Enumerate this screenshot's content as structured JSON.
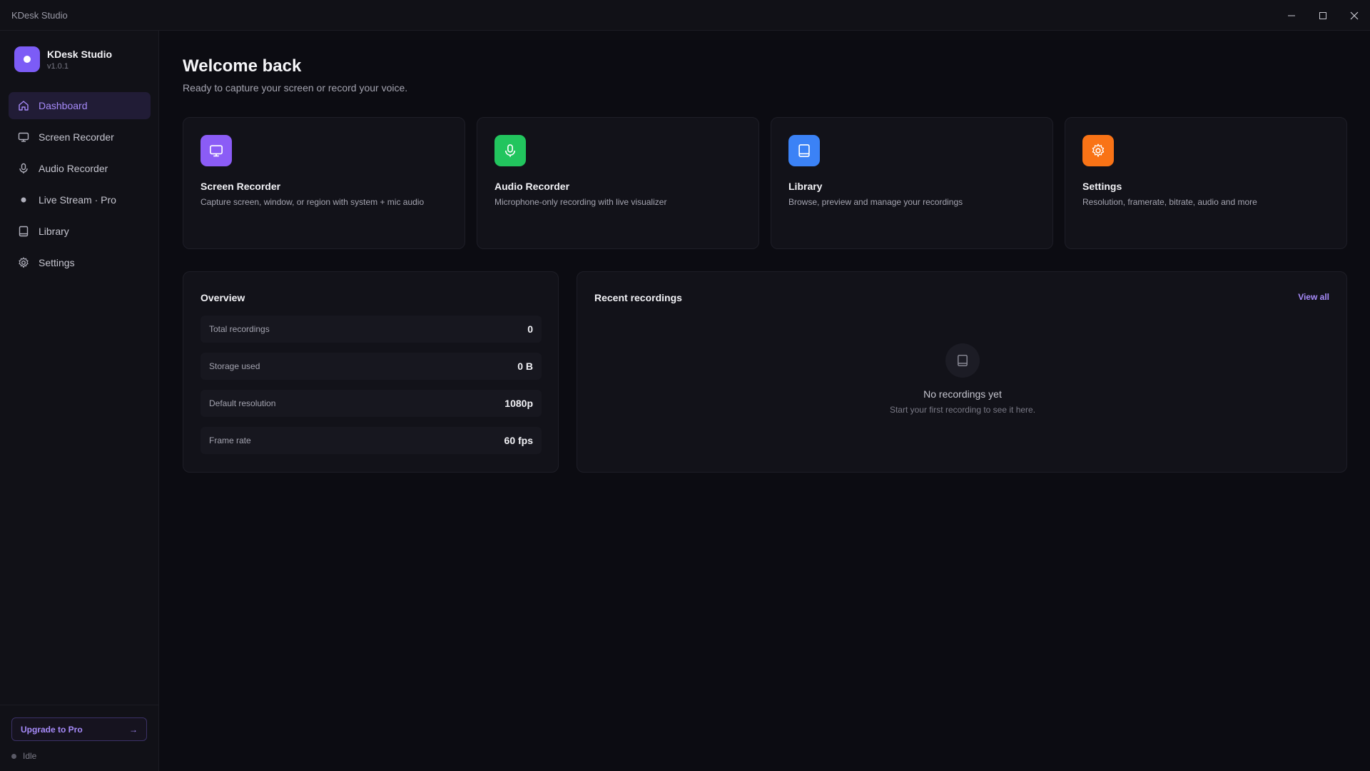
{
  "window": {
    "title": "KDesk Studio",
    "controls": [
      "minimize-icon",
      "maximize-icon",
      "close-icon"
    ]
  },
  "sidebar": {
    "brand_name": "KDesk Studio",
    "version": "v1.0.1",
    "items": [
      {
        "label": "Dashboard",
        "icon": "home-icon",
        "active": true
      },
      {
        "label": "Screen Recorder",
        "icon": "monitor-icon",
        "active": false
      },
      {
        "label": "Audio Recorder",
        "icon": "microphone-icon",
        "active": false
      },
      {
        "label": "Live Stream · Pro",
        "icon": "dot-icon",
        "active": false
      },
      {
        "label": "Library",
        "icon": "book-icon",
        "active": false
      },
      {
        "label": "Settings",
        "icon": "gear-icon",
        "active": false
      }
    ],
    "upgrade_label": "Upgrade to Pro",
    "upgrade_arrow": "→",
    "status": "Idle"
  },
  "header": {
    "title": "Welcome back",
    "subtitle": "Ready to capture your screen or record your voice."
  },
  "cards": [
    {
      "title": "Screen Recorder",
      "description": "Capture screen, window, or region with system + mic audio",
      "icon": "monitor-icon",
      "color": "#8b5cf6"
    },
    {
      "title": "Audio Recorder",
      "description": "Microphone-only recording with live visualizer",
      "icon": "microphone-icon",
      "color": "#22c55e"
    },
    {
      "title": "Library",
      "description": "Browse, preview and manage your recordings",
      "icon": "book-icon",
      "color": "#3b82f6"
    },
    {
      "title": "Settings",
      "description": "Resolution, framerate, bitrate, audio and more",
      "icon": "gear-icon",
      "color": "#f97316"
    }
  ],
  "overview": {
    "title": "Overview",
    "stats": [
      {
        "label": "Total recordings",
        "value": "0"
      },
      {
        "label": "Storage used",
        "value": "0 B"
      },
      {
        "label": "Default resolution",
        "value": "1080p"
      },
      {
        "label": "Frame rate",
        "value": "60 fps"
      }
    ]
  },
  "recent": {
    "title": "Recent recordings",
    "view_all": "View all",
    "empty_title": "No recordings yet",
    "empty_subtitle": "Start your first recording to see it here."
  },
  "colors": {
    "accent": "#a78bfa",
    "brand": "#7c5cf6",
    "background": "#0c0c12"
  }
}
